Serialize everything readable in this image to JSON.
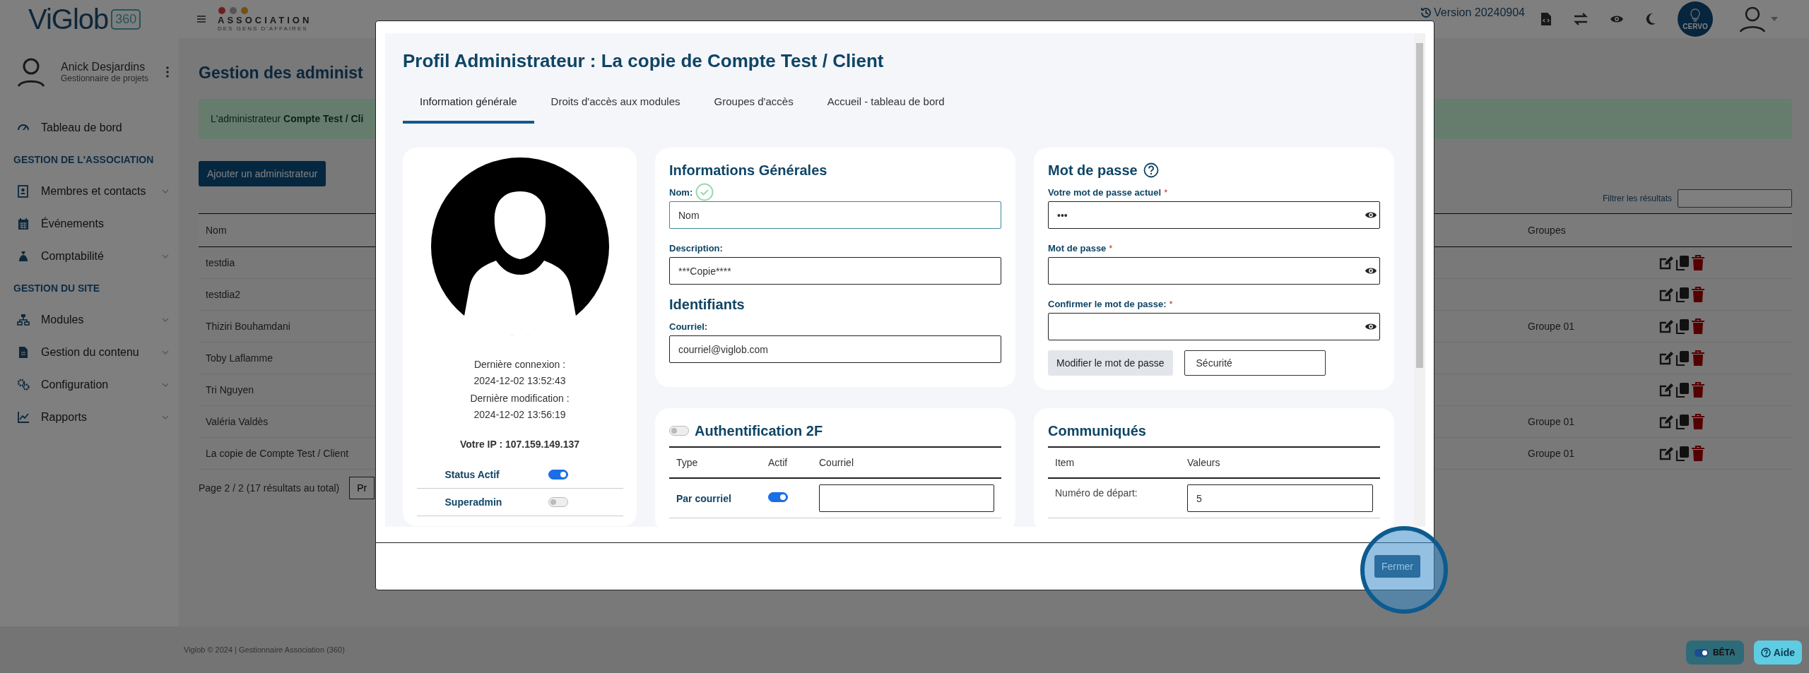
{
  "header": {
    "logo": "ViGlob",
    "logo_badge": "360",
    "association_name": "ASSOCIATION",
    "association_tagline": "DES GENS D'AFFAIRES",
    "version": "Version 20240904",
    "assistant_badge": "CERVO"
  },
  "sidebar": {
    "user": {
      "name": "Anick Desjardins",
      "role": "Gestionnaire de projets"
    },
    "items": [
      {
        "kind": "link",
        "label": "Tableau de bord",
        "has_submenu": false
      },
      {
        "kind": "heading",
        "label": "GESTION DE L'ASSOCIATION"
      },
      {
        "kind": "link",
        "label": "Membres et contacts",
        "has_submenu": true
      },
      {
        "kind": "link",
        "label": "Événements",
        "has_submenu": false
      },
      {
        "kind": "link",
        "label": "Comptabilité",
        "has_submenu": true
      },
      {
        "kind": "heading",
        "label": "GESTION DU SITE"
      },
      {
        "kind": "link",
        "label": "Modules",
        "has_submenu": true
      },
      {
        "kind": "link",
        "label": "Gestion du contenu",
        "has_submenu": true
      },
      {
        "kind": "link",
        "label": "Configuration",
        "has_submenu": true
      },
      {
        "kind": "link",
        "label": "Rapports",
        "has_submenu": true
      }
    ]
  },
  "main": {
    "title": "Gestion des administ",
    "alert": "L'administrateur **Compte Test / Cli**",
    "add_button": "Ajouter un administrateur",
    "filter_label": "Filtrer les résultats",
    "table": {
      "columns": [
        "Nom",
        "Groupes"
      ],
      "rows": [
        {
          "name": "testdia"
        },
        {
          "name": "testdia2"
        },
        {
          "name": "Thiziri Bouhamdani",
          "groups": "Groupe 01"
        },
        {
          "name": "Toby Laflamme"
        },
        {
          "name": "Tri Nguyen"
        },
        {
          "name": "Valéria Valdès",
          "groups": "Groupe 01"
        },
        {
          "name": "La copie de Compte Test / Client",
          "groups": "Groupe 01"
        }
      ]
    },
    "pagination": {
      "summary": "Page 2 / 2 (17 résultats au total)",
      "previous": "Pr"
    }
  },
  "footer": {
    "copyright": "Viglob © 2024 | Gestionnaire Association (360)",
    "beta": {
      "label": "BÊTA",
      "on": true
    },
    "help": "Aide"
  },
  "modal": {
    "title": "Profil Administrateur : La copie de Compte Test / Client",
    "tabs": [
      {
        "label": "Information générale",
        "selected": true
      },
      {
        "label": "Droits d'accès aux modules",
        "selected": false
      },
      {
        "label": "Groupes d'accès",
        "selected": false
      },
      {
        "label": "Accueil - tableau de bord",
        "selected": false
      }
    ],
    "profile": {
      "last_login_label": "Dernière connexion :",
      "last_login": "2024-12-02 13:52:43",
      "last_change_label": "Dernière modification :",
      "last_change": "2024-12-02 13:56:19",
      "ip": "Votre IP : 107.159.149.137",
      "toggles": [
        {
          "label": "Status Actif",
          "on": true
        },
        {
          "label": "Superadmin",
          "on": false
        }
      ]
    },
    "general": {
      "title": "Informations Générales",
      "fields": [
        {
          "label": "Nom:",
          "value": "Nom",
          "valid": true
        },
        {
          "label": "Description:",
          "value": "***Copie****",
          "valid": false
        }
      ]
    },
    "identifiers": {
      "title": "Identifiants",
      "fields": [
        {
          "label": "Courriel:",
          "value": "courriel@viglob.com",
          "valid": false
        }
      ]
    },
    "password": {
      "title": "Mot de passe",
      "fields": [
        {
          "label": "Votre mot de passe actuel",
          "mark": "*",
          "value": "•••"
        },
        {
          "label": "Mot de passe",
          "mark": "*"
        },
        {
          "label": "Confirmer le mot de passe:",
          "mark": "*"
        }
      ],
      "change_button": "Modifier le mot de passe",
      "strength": "Sécurité"
    },
    "two_factor": {
      "title": "Authentification 2F",
      "on": false,
      "columns": [
        "Type",
        "Actif",
        "Courriel"
      ],
      "rows": [
        {
          "type": "Par courriel",
          "on": true
        }
      ]
    },
    "communiques": {
      "title": "Communiqués",
      "columns": [
        "Item",
        "Valeurs"
      ],
      "rows": [
        {
          "item": "Numéro de départ:",
          "value": "5"
        }
      ]
    },
    "close_button": "Fermer"
  }
}
